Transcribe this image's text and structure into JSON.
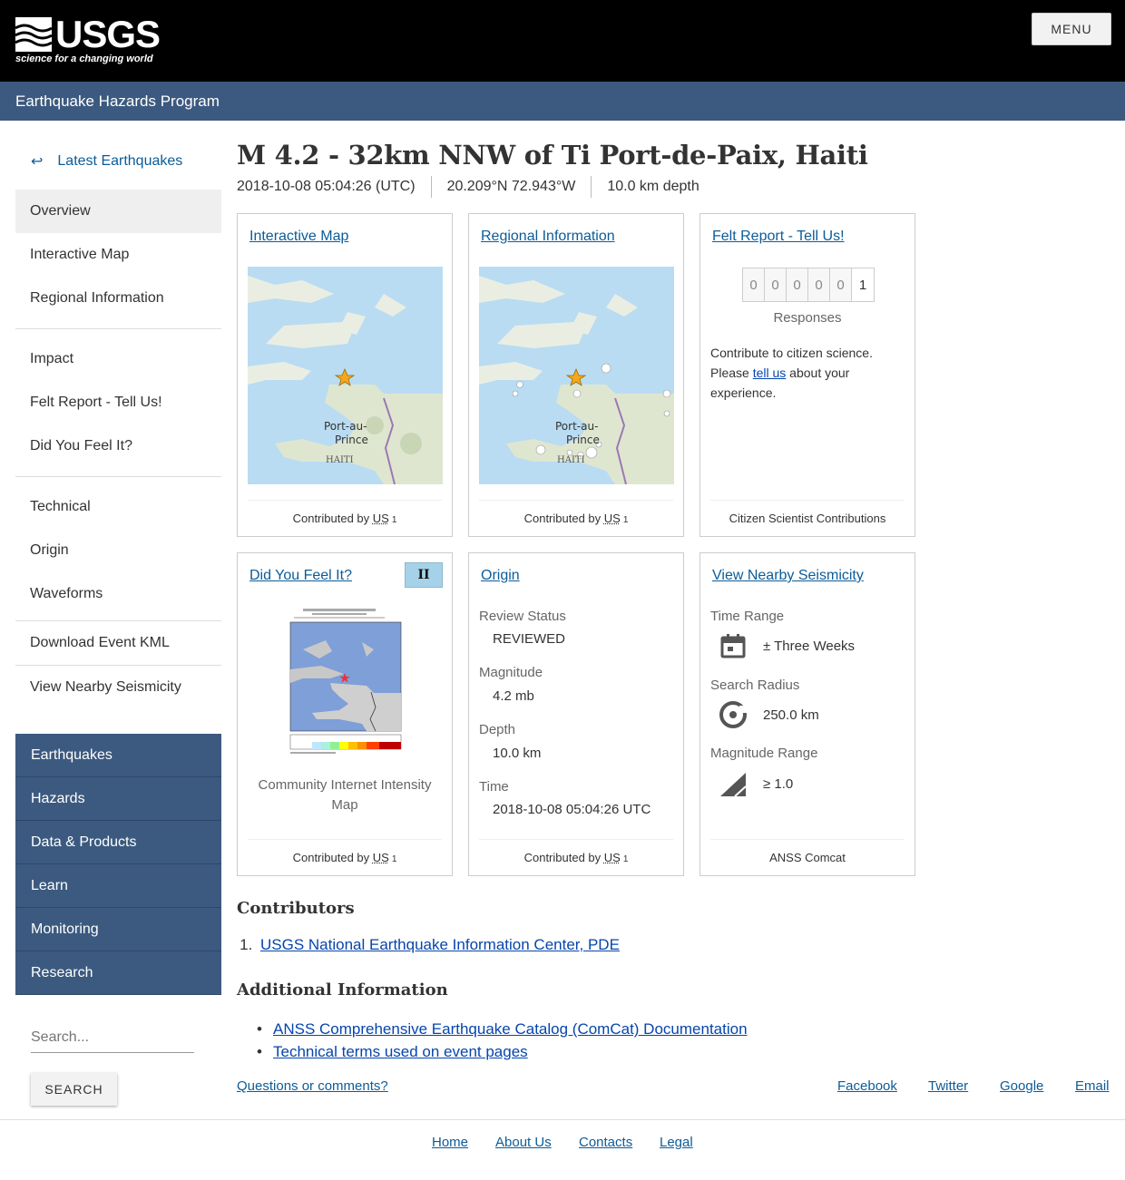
{
  "header": {
    "logo_text": "USGS",
    "logo_tagline": "science for a changing world",
    "menu_label": "MENU",
    "program_title": "Earthquake Hazards Program"
  },
  "sidebar": {
    "back_label": "Latest Earthquakes",
    "items": [
      {
        "label": "Overview",
        "active": true
      },
      {
        "label": "Interactive Map"
      },
      {
        "label": "Regional Information"
      },
      {
        "label": "Impact"
      },
      {
        "label": "Felt Report - Tell Us!"
      },
      {
        "label": "Did You Feel It?"
      },
      {
        "label": "Technical"
      },
      {
        "label": "Origin"
      },
      {
        "label": "Waveforms"
      },
      {
        "label": "Download Event KML"
      },
      {
        "label": "View Nearby Seismicity"
      }
    ],
    "site_nav": [
      "Earthquakes",
      "Hazards",
      "Data & Products",
      "Learn",
      "Monitoring",
      "Research"
    ],
    "search_placeholder": "Search...",
    "search_button": "SEARCH"
  },
  "event": {
    "title": "M 4.2 - 32km NNW of Ti Port-de-Paix, Haiti",
    "time": "2018-10-08 05:04:26 (UTC)",
    "location": "20.209°N 72.943°W",
    "depth": "10.0 km depth"
  },
  "cards": {
    "interactive_map": {
      "title": "Interactive Map",
      "map_label_1": "Port-au-",
      "map_label_2": "Prince",
      "map_label_3": "HAITI",
      "contributed_by": "Contributed by",
      "contributor": "US",
      "footnote": "1"
    },
    "regional": {
      "title": "Regional Information",
      "map_label_1": "Port-au-",
      "map_label_2": "Prince",
      "map_label_3": "HAITI",
      "contributed_by": "Contributed by",
      "contributor": "US",
      "footnote": "1"
    },
    "felt_report": {
      "title": "Felt Report - Tell Us!",
      "digits": [
        "0",
        "0",
        "0",
        "0",
        "0",
        "1"
      ],
      "responses_label": "Responses",
      "text_1": "Contribute to citizen science. Please ",
      "link": "tell us",
      "text_2": " about your experience.",
      "footer": "Citizen Scientist Contributions"
    },
    "dyfi": {
      "title": "Did You Feel It?",
      "intensity": "II",
      "caption": "Community Internet Intensity Map",
      "contributed_by": "Contributed by",
      "contributor": "US",
      "footnote": "1"
    },
    "origin": {
      "title": "Origin",
      "review_label": "Review Status",
      "review_value": "REVIEWED",
      "magnitude_label": "Magnitude",
      "magnitude_value": "4.2 mb",
      "depth_label": "Depth",
      "depth_value": "10.0 km",
      "time_label": "Time",
      "time_value": "2018-10-08 05:04:26 UTC",
      "contributed_by": "Contributed by",
      "contributor": "US",
      "footnote": "1"
    },
    "seismicity": {
      "title": "View Nearby Seismicity",
      "time_range_label": "Time Range",
      "time_range_value": "± Three Weeks",
      "radius_label": "Search Radius",
      "radius_value": "250.0 km",
      "mag_range_label": "Magnitude Range",
      "mag_range_value": "≥ 1.0",
      "footer": "ANSS Comcat"
    }
  },
  "contributors": {
    "heading": "Contributors",
    "items": [
      "USGS National Earthquake Information Center, PDE"
    ]
  },
  "additional": {
    "heading": "Additional Information",
    "items": [
      "ANSS Comprehensive Earthquake Catalog (ComCat) Documentation",
      "Technical terms used on event pages"
    ]
  },
  "footer": {
    "questions": "Questions or comments?",
    "social": [
      "Facebook",
      "Twitter",
      "Google",
      "Email"
    ],
    "links": [
      "Home",
      "About Us",
      "Contacts",
      "Legal"
    ]
  },
  "colors": {
    "header_bg": "#000000",
    "program_bar": "#3c5a7f",
    "link": "#0b5c99",
    "dyfi_badge": "#a5d2e8"
  }
}
